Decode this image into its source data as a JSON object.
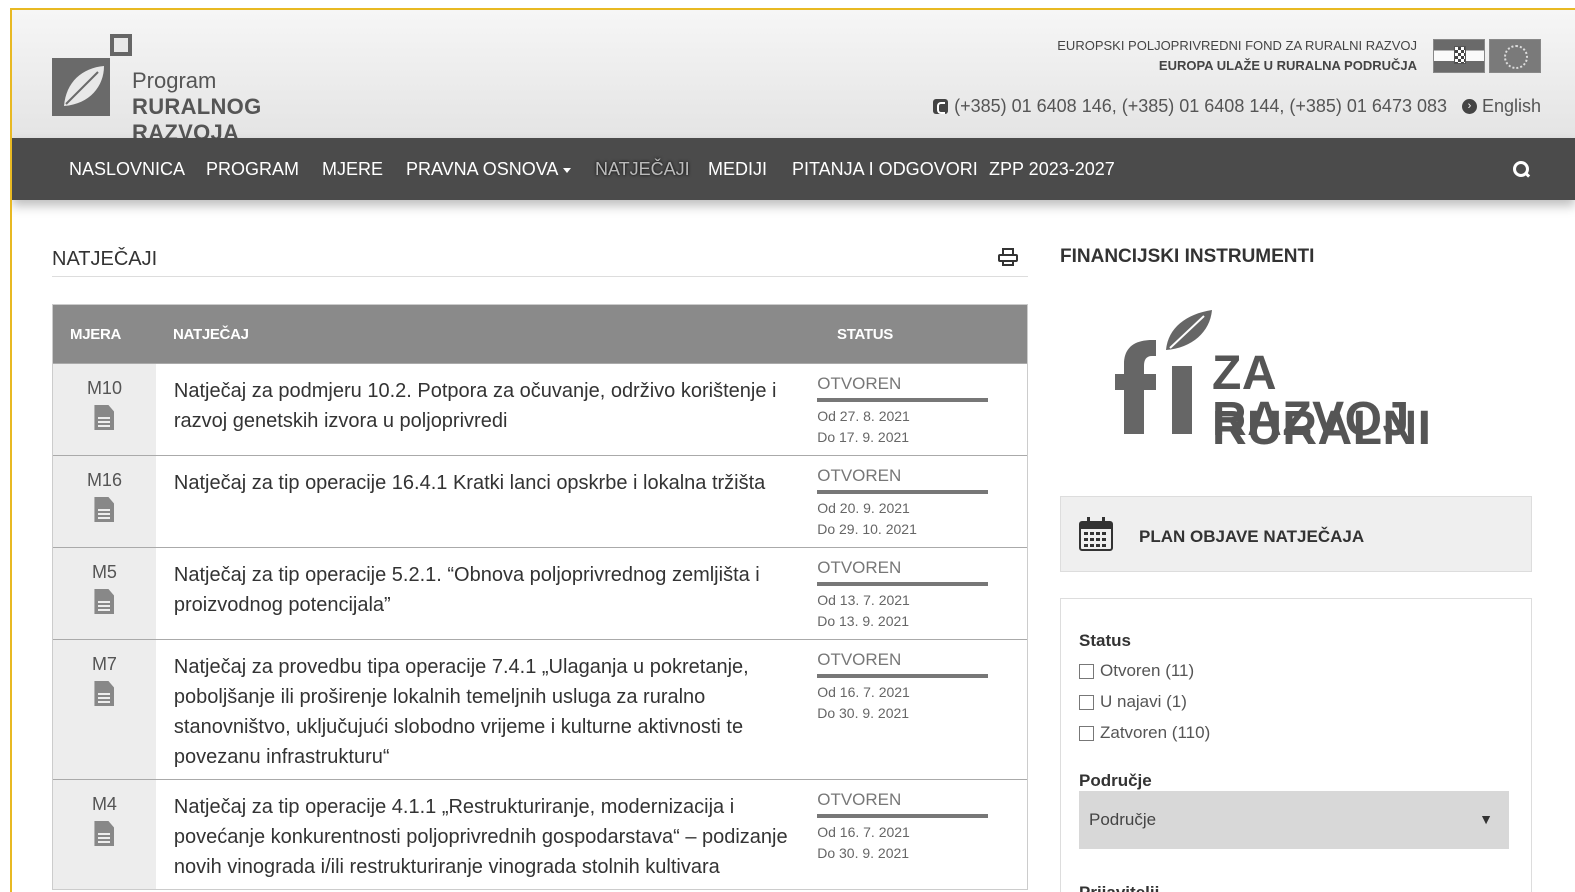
{
  "header": {
    "logo_line1": "Program",
    "logo_line2": "RURALNOG RAZVOJA",
    "eu_line1": "EUROPSKI POLJOPRIVREDNI FOND ZA RURALNI RAZVOJ",
    "eu_line2": "EUROPA ULAŽE U RURALNA PODRUČJA",
    "phones": "(+385) 01 6408 146, (+385) 01 6408 144, (+385) 01 6473 083",
    "language": "English"
  },
  "nav": {
    "items": [
      {
        "label": "NASLOVNICA"
      },
      {
        "label": "PROGRAM"
      },
      {
        "label": "MJERE"
      },
      {
        "label": "PRAVNA OSNOVA"
      },
      {
        "label": "NATJEČAJI"
      },
      {
        "label": "MEDIJI"
      },
      {
        "label": "PITANJA I ODGOVORI"
      },
      {
        "label": "ZPP 2023-2027"
      }
    ]
  },
  "main": {
    "title": "NATJEČAJI",
    "columns": {
      "measure": "MJERA",
      "tender": "NATJEČAJ",
      "status": "STATUS"
    },
    "rows": [
      {
        "measure": "M10",
        "title": "Natječaj za podmjeru 10.2. Potpora za očuvanje, održivo korištenje i razvoj genetskih izvora u poljoprivredi",
        "status": "OTVOREN",
        "from": "Od 27. 8. 2021",
        "to": "Do 17. 9. 2021"
      },
      {
        "measure": "M16",
        "title": "Natječaj za tip operacije 16.4.1 Kratki lanci opskrbe i lokalna tržišta",
        "status": "OTVOREN",
        "from": "Od 20. 9. 2021",
        "to": "Do 29. 10. 2021"
      },
      {
        "measure": "M5",
        "title": "Natječaj za tip operacije 5.2.1. “Obnova poljoprivrednog zemljišta i proizvodnog potencijala”",
        "status": "OTVOREN",
        "from": "Od 13. 7. 2021",
        "to": "Do 13. 9. 2021"
      },
      {
        "measure": "M7",
        "title": "Natječaj za provedbu tipa operacije 7.4.1 „Ulaganja u pokretanje, poboljšanje ili proširenje lokalnih temeljnih usluga za ruralno stanovništvo, uključujući slobodno vrijeme i kulturne aktivnosti te povezanu infrastrukturu“",
        "status": "OTVOREN",
        "from": "Od 16. 7. 2021",
        "to": "Do 30. 9. 2021"
      },
      {
        "measure": "M4",
        "title": "Natječaj za tip operacije 4.1.1 „Restrukturiranje, modernizacija i povećanje konkurentnosti poljoprivrednih gospodarstava“ – podizanje novih vinograda i/ili restrukturiranje vinograda stolnih kultivara",
        "status": "OTVOREN",
        "from": "Od 16. 7. 2021",
        "to": "Do 30. 9. 2021"
      }
    ]
  },
  "sidebar": {
    "title": "FINANCIJSKI INSTRUMENTI",
    "fi_logo_line1": "ZA RURALNI",
    "fi_logo_line2": "RAZVOJ",
    "plan_label": "PLAN OBJAVE NATJEČAJA",
    "filter": {
      "status_heading": "Status",
      "options": [
        {
          "label": "Otvoren (11)"
        },
        {
          "label": "U najavi (1)"
        },
        {
          "label": "Zatvoren (110)"
        }
      ],
      "area_heading": "Područje",
      "area_selected": "Područje",
      "applicants_heading": "Prijavitelji"
    }
  }
}
